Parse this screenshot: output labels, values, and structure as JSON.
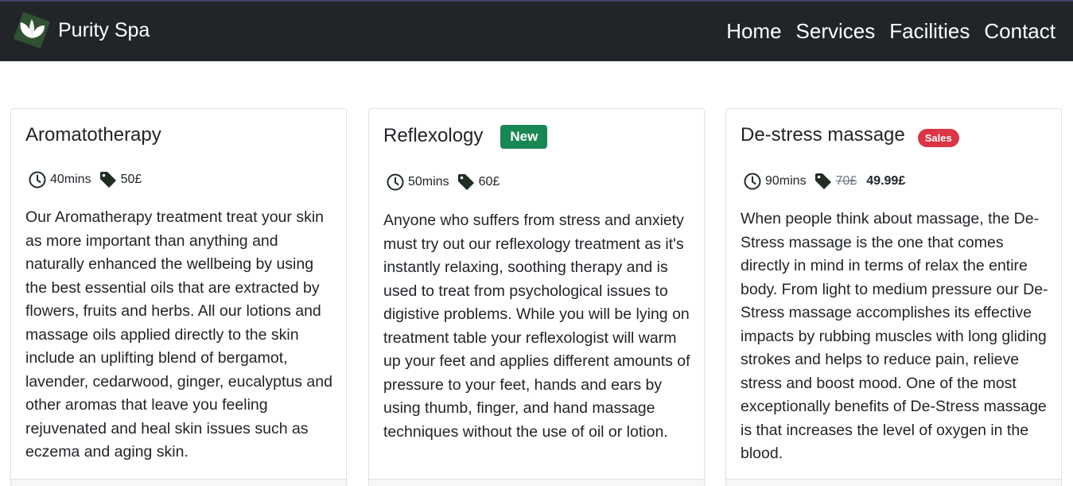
{
  "brand": {
    "name": "Purity Spa",
    "logo_icon": "lotus-leaf-logo"
  },
  "nav": {
    "items": [
      "Home",
      "Services",
      "Facilities",
      "Contact"
    ]
  },
  "colors": {
    "navbar_bg": "#212529",
    "logo_green": "#2f5233",
    "badge_new": "#198754",
    "badge_sale": "#dc3545",
    "icon_color": "#1f2d22"
  },
  "services": [
    {
      "title": "Aromatotherapy",
      "badge": "",
      "duration": "40mins",
      "price": "50£",
      "description": "Our Aromatherapy treatment treat your skin as more important than anything and naturally enhanced the wellbeing by using the best essential oils that are extracted by flowers, fruits and herbs. All our lotions and massage oils applied directly to the skin include an uplifting blend of bergamot, lavender, cedarwood, ginger, eucalyptus and other aromas that leave you feeling rejuvenated and heal skin issues such as eczema and aging skin."
    },
    {
      "title": "Reflexology",
      "badge": "New",
      "duration": "50mins",
      "price": "60£",
      "description": "Anyone who suffers from stress and anxiety must try out our reflexology treatment as it's instantly relaxing, soothing therapy and is used to treat from psychological issues to digistive problems. While you will be lying on treatment table your reflexologist will warm up your feet and applies different amounts of pressure to your feet, hands and ears by using thumb, finger, and hand massage techniques without the use of oil or lotion."
    },
    {
      "title": "De-stress massage",
      "badge": "Sales",
      "duration": "90mins",
      "old_price": "70£",
      "price": "49.99£",
      "description": "When people think about massage, the De-Stress massage is the one that comes directly in mind in terms of relax the entire body. From light to medium pressure our De-Stress massage accomplishes its effective impacts by rubbing muscles with long gliding strokes and helps to reduce pain, relieve stress and boost mood. One of the most exceptionally benefits of De-Stress massage is that increases the level of oxygen in the blood."
    }
  ]
}
